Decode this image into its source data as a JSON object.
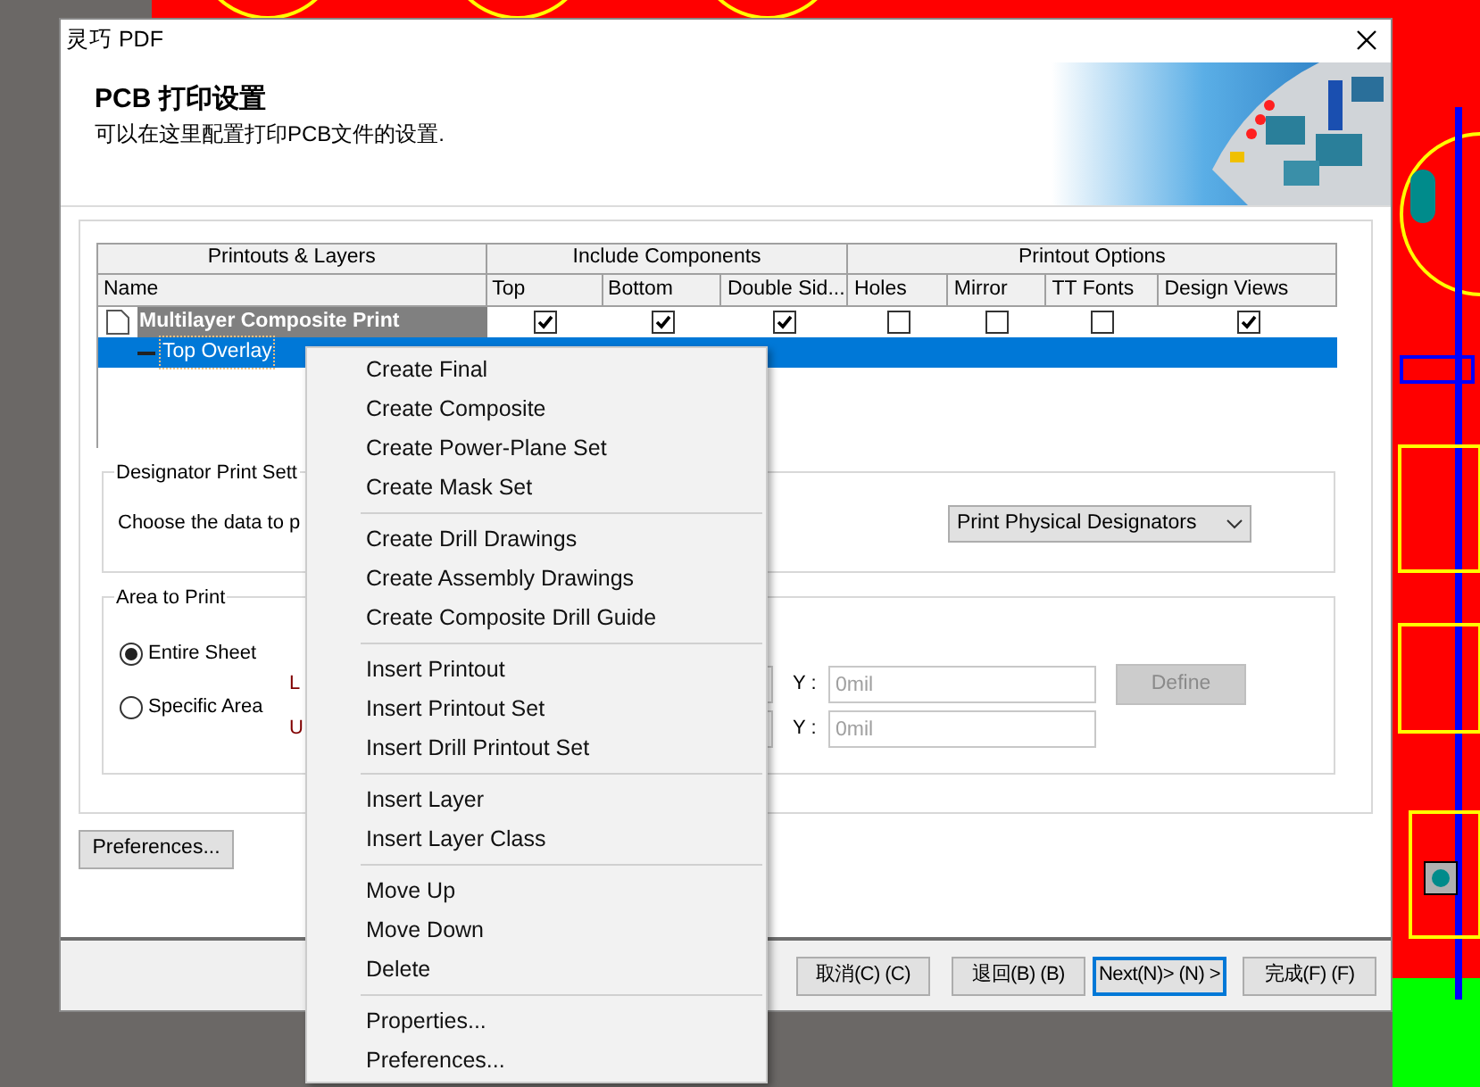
{
  "window": {
    "title": "灵巧 PDF"
  },
  "header": {
    "title": "PCB 打印设置",
    "subtitle": "可以在这里配置打印PCB文件的设置."
  },
  "table": {
    "groups": [
      "Printouts & Layers",
      "Include Components",
      "Printout Options"
    ],
    "columns": [
      "Name",
      "Top",
      "Bottom",
      "Double Sid...",
      "Holes",
      "Mirror",
      "TT Fonts",
      "Design Views"
    ],
    "rows": [
      {
        "kind": "printout",
        "name": "Multilayer Composite Print",
        "selected": false,
        "checks": [
          true,
          true,
          true,
          false,
          false,
          false,
          true
        ]
      },
      {
        "kind": "layer",
        "name": "Top Overlay",
        "selected": true
      }
    ]
  },
  "designator_group": {
    "legend": "Designator Print Sett",
    "prompt": "Choose the data to p",
    "dropdown": {
      "value": "Print Physical Designators"
    }
  },
  "area_group": {
    "legend": "Area to Print",
    "options": [
      {
        "label": "Entire Sheet",
        "selected": true
      },
      {
        "label": "Specific Area",
        "selected": false
      }
    ],
    "coordinates": [
      {
        "label": "L",
        "y_label": "Y :",
        "y_placeholder": "0mil"
      },
      {
        "label": "U",
        "y_label": "Y :",
        "y_placeholder": "0mil"
      }
    ],
    "define_button": {
      "label": "Define",
      "disabled": true
    }
  },
  "preferences_button": "Preferences...",
  "footer_buttons": [
    {
      "label": "取消(C) (C)",
      "focused": false
    },
    {
      "label": "退回(B) (B)",
      "focused": false
    },
    {
      "label": "Next(N)> (N) >",
      "focused": true
    },
    {
      "label": "完成(F) (F)",
      "focused": false
    }
  ],
  "context_menu": {
    "groups": [
      [
        "Create Final",
        "Create Composite",
        "Create Power-Plane Set",
        "Create Mask Set"
      ],
      [
        "Create Drill Drawings",
        "Create Assembly Drawings",
        "Create Composite Drill Guide"
      ],
      [
        "Insert Printout",
        "Insert Printout Set",
        "Insert Drill Printout Set"
      ],
      [
        "Insert Layer",
        "Insert Layer Class"
      ],
      [
        "Move Up",
        "Move Down",
        "Delete"
      ],
      [
        "Properties...",
        "Preferences..."
      ]
    ]
  }
}
